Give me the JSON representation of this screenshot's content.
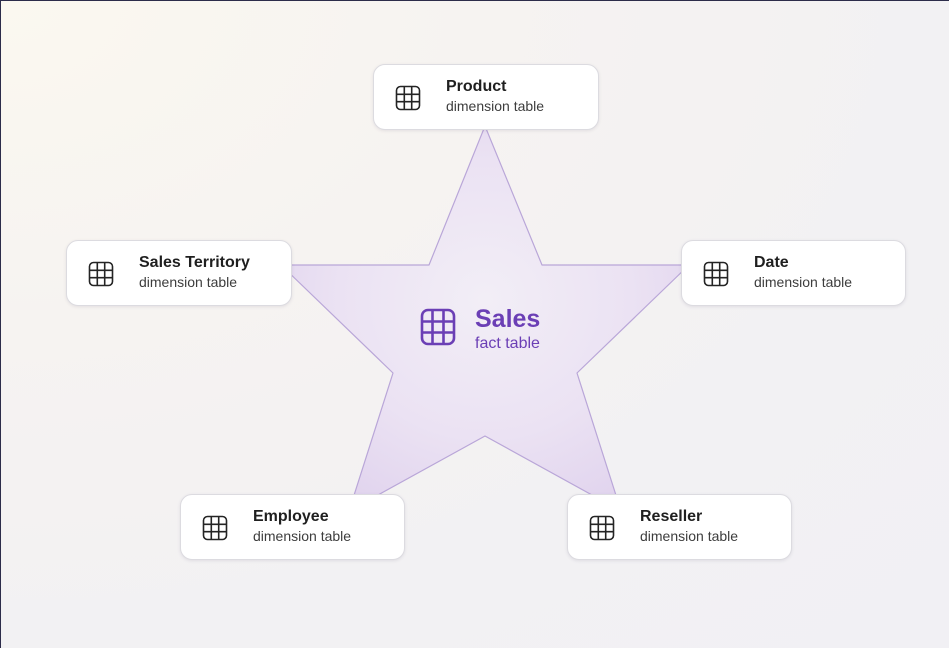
{
  "diagram": {
    "center": {
      "title": "Sales",
      "subtitle": "fact table",
      "icon": "table-grid-icon"
    },
    "nodes": [
      {
        "id": "product",
        "title": "Product",
        "subtitle": "dimension table",
        "icon": "table-grid-icon"
      },
      {
        "id": "sales-territory",
        "title": "Sales Territory",
        "subtitle": "dimension table",
        "icon": "table-grid-icon"
      },
      {
        "id": "date",
        "title": "Date",
        "subtitle": "dimension table",
        "icon": "table-grid-icon"
      },
      {
        "id": "employee",
        "title": "Employee",
        "subtitle": "dimension table",
        "icon": "table-grid-icon"
      },
      {
        "id": "reseller",
        "title": "Reseller",
        "subtitle": "dimension table",
        "icon": "table-grid-icon"
      }
    ]
  },
  "colors": {
    "accent": "#6b3fb5",
    "star_fill": "#ece3f3",
    "star_stroke": "#b9a6d8",
    "card_border": "#dcdbe0",
    "text_dark": "#1f1f1f"
  }
}
